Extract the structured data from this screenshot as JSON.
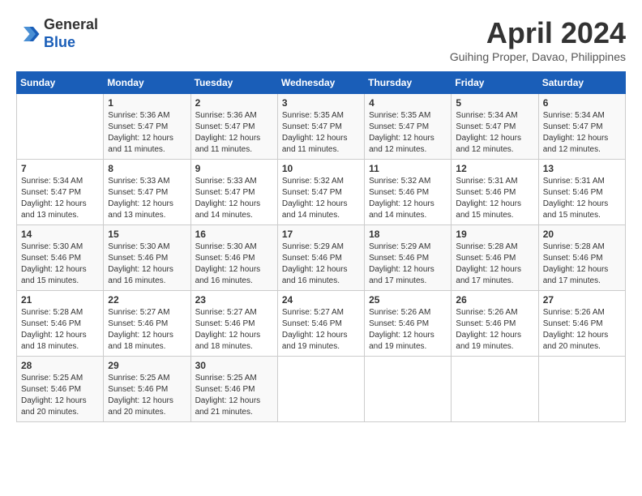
{
  "header": {
    "logo_line1": "General",
    "logo_line2": "Blue",
    "month_title": "April 2024",
    "location": "Guihing Proper, Davao, Philippines"
  },
  "days_of_week": [
    "Sunday",
    "Monday",
    "Tuesday",
    "Wednesday",
    "Thursday",
    "Friday",
    "Saturday"
  ],
  "weeks": [
    [
      {
        "num": "",
        "info": ""
      },
      {
        "num": "1",
        "info": "Sunrise: 5:36 AM\nSunset: 5:47 PM\nDaylight: 12 hours\nand 11 minutes."
      },
      {
        "num": "2",
        "info": "Sunrise: 5:36 AM\nSunset: 5:47 PM\nDaylight: 12 hours\nand 11 minutes."
      },
      {
        "num": "3",
        "info": "Sunrise: 5:35 AM\nSunset: 5:47 PM\nDaylight: 12 hours\nand 11 minutes."
      },
      {
        "num": "4",
        "info": "Sunrise: 5:35 AM\nSunset: 5:47 PM\nDaylight: 12 hours\nand 12 minutes."
      },
      {
        "num": "5",
        "info": "Sunrise: 5:34 AM\nSunset: 5:47 PM\nDaylight: 12 hours\nand 12 minutes."
      },
      {
        "num": "6",
        "info": "Sunrise: 5:34 AM\nSunset: 5:47 PM\nDaylight: 12 hours\nand 12 minutes."
      }
    ],
    [
      {
        "num": "7",
        "info": "Sunrise: 5:34 AM\nSunset: 5:47 PM\nDaylight: 12 hours\nand 13 minutes."
      },
      {
        "num": "8",
        "info": "Sunrise: 5:33 AM\nSunset: 5:47 PM\nDaylight: 12 hours\nand 13 minutes."
      },
      {
        "num": "9",
        "info": "Sunrise: 5:33 AM\nSunset: 5:47 PM\nDaylight: 12 hours\nand 14 minutes."
      },
      {
        "num": "10",
        "info": "Sunrise: 5:32 AM\nSunset: 5:47 PM\nDaylight: 12 hours\nand 14 minutes."
      },
      {
        "num": "11",
        "info": "Sunrise: 5:32 AM\nSunset: 5:46 PM\nDaylight: 12 hours\nand 14 minutes."
      },
      {
        "num": "12",
        "info": "Sunrise: 5:31 AM\nSunset: 5:46 PM\nDaylight: 12 hours\nand 15 minutes."
      },
      {
        "num": "13",
        "info": "Sunrise: 5:31 AM\nSunset: 5:46 PM\nDaylight: 12 hours\nand 15 minutes."
      }
    ],
    [
      {
        "num": "14",
        "info": "Sunrise: 5:30 AM\nSunset: 5:46 PM\nDaylight: 12 hours\nand 15 minutes."
      },
      {
        "num": "15",
        "info": "Sunrise: 5:30 AM\nSunset: 5:46 PM\nDaylight: 12 hours\nand 16 minutes."
      },
      {
        "num": "16",
        "info": "Sunrise: 5:30 AM\nSunset: 5:46 PM\nDaylight: 12 hours\nand 16 minutes."
      },
      {
        "num": "17",
        "info": "Sunrise: 5:29 AM\nSunset: 5:46 PM\nDaylight: 12 hours\nand 16 minutes."
      },
      {
        "num": "18",
        "info": "Sunrise: 5:29 AM\nSunset: 5:46 PM\nDaylight: 12 hours\nand 17 minutes."
      },
      {
        "num": "19",
        "info": "Sunrise: 5:28 AM\nSunset: 5:46 PM\nDaylight: 12 hours\nand 17 minutes."
      },
      {
        "num": "20",
        "info": "Sunrise: 5:28 AM\nSunset: 5:46 PM\nDaylight: 12 hours\nand 17 minutes."
      }
    ],
    [
      {
        "num": "21",
        "info": "Sunrise: 5:28 AM\nSunset: 5:46 PM\nDaylight: 12 hours\nand 18 minutes."
      },
      {
        "num": "22",
        "info": "Sunrise: 5:27 AM\nSunset: 5:46 PM\nDaylight: 12 hours\nand 18 minutes."
      },
      {
        "num": "23",
        "info": "Sunrise: 5:27 AM\nSunset: 5:46 PM\nDaylight: 12 hours\nand 18 minutes."
      },
      {
        "num": "24",
        "info": "Sunrise: 5:27 AM\nSunset: 5:46 PM\nDaylight: 12 hours\nand 19 minutes."
      },
      {
        "num": "25",
        "info": "Sunrise: 5:26 AM\nSunset: 5:46 PM\nDaylight: 12 hours\nand 19 minutes."
      },
      {
        "num": "26",
        "info": "Sunrise: 5:26 AM\nSunset: 5:46 PM\nDaylight: 12 hours\nand 19 minutes."
      },
      {
        "num": "27",
        "info": "Sunrise: 5:26 AM\nSunset: 5:46 PM\nDaylight: 12 hours\nand 20 minutes."
      }
    ],
    [
      {
        "num": "28",
        "info": "Sunrise: 5:25 AM\nSunset: 5:46 PM\nDaylight: 12 hours\nand 20 minutes."
      },
      {
        "num": "29",
        "info": "Sunrise: 5:25 AM\nSunset: 5:46 PM\nDaylight: 12 hours\nand 20 minutes."
      },
      {
        "num": "30",
        "info": "Sunrise: 5:25 AM\nSunset: 5:46 PM\nDaylight: 12 hours\nand 21 minutes."
      },
      {
        "num": "",
        "info": ""
      },
      {
        "num": "",
        "info": ""
      },
      {
        "num": "",
        "info": ""
      },
      {
        "num": "",
        "info": ""
      }
    ]
  ]
}
